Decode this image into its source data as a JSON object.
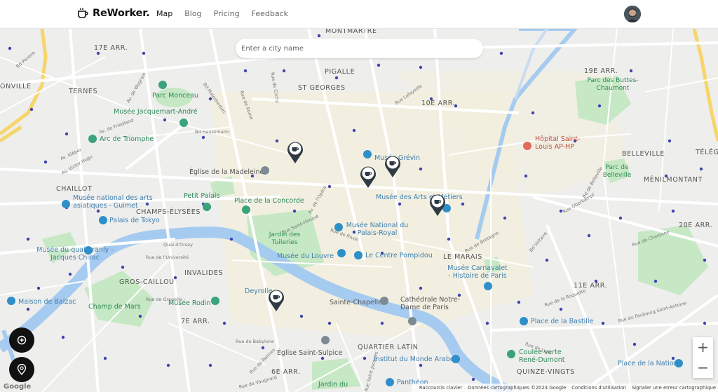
{
  "app": {
    "logo_text": "ReWorker.",
    "logo_icon": "coffee-cup-icon"
  },
  "nav": [
    {
      "label": "Map",
      "active": true
    },
    {
      "label": "Blog",
      "active": false
    },
    {
      "label": "Pricing",
      "active": false
    },
    {
      "label": "Feedback",
      "active": false
    }
  ],
  "search": {
    "placeholder": "Enter a city name",
    "value": ""
  },
  "map": {
    "districts": [
      "MONTMARTRE",
      "17E ARR.",
      "PIGALLE",
      "ST GEORGES",
      "19E ARR.",
      "10E ARR.",
      "BELLEVILLE",
      "TERNES",
      "CHAILLOT",
      "CHAMPS-ÉLYSÉES",
      "MÉNILMONTANT",
      "20E ARR.",
      "LE MARAIS",
      "INVALIDES",
      "GROS-CAILLOU",
      "11E ARR.",
      "7E ARR.",
      "QUARTIER LATIN",
      "6E ARR.",
      "QUINZE-VINGTS",
      "ONVILLE",
      "TÉLÉG"
    ],
    "pois": [
      {
        "label": "Parc Monceau",
        "kind": "green"
      },
      {
        "label": "Musée Jacquemart-André",
        "kind": "green"
      },
      {
        "label": "Parc des Buttes-Chaumont",
        "kind": "green"
      },
      {
        "label": "Arc de Triomphe",
        "kind": "green"
      },
      {
        "label": "Musée Grévin",
        "kind": "blue"
      },
      {
        "label": "Hôpital Saint-Louis AP-HP",
        "kind": "red"
      },
      {
        "label": "Église de la Madeleine",
        "kind": "gray"
      },
      {
        "label": "Parc de Belleville",
        "kind": "green"
      },
      {
        "label": "Musée national des arts asiatiques - Guimet",
        "kind": "blue"
      },
      {
        "label": "Petit Palais",
        "kind": "green"
      },
      {
        "label": "Place de la Concorde",
        "kind": "green"
      },
      {
        "label": "Musée des Arts et Métiers",
        "kind": "blue"
      },
      {
        "label": "Palais de Tokyo",
        "kind": "blue"
      },
      {
        "label": "Jardin des Tuileries",
        "kind": "green"
      },
      {
        "label": "Musée National du Palais-Royal",
        "kind": "blue"
      },
      {
        "label": "Musée du quai Branly - Jacques Chirac",
        "kind": "blue"
      },
      {
        "label": "Musée du Louvre",
        "kind": "blue"
      },
      {
        "label": "Le Centre Pompidou",
        "kind": "blue"
      },
      {
        "label": "Musée Carnavalet - Histoire de Paris",
        "kind": "blue"
      },
      {
        "label": "Deyrolle",
        "kind": "blue"
      },
      {
        "label": "Maison de Balzac",
        "kind": "blue"
      },
      {
        "label": "Champ de Mars",
        "kind": "green"
      },
      {
        "label": "Musée Rodin",
        "kind": "green"
      },
      {
        "label": "Sainte-Chapelle",
        "kind": "gray"
      },
      {
        "label": "Cathédrale Notre-Dame de Paris",
        "kind": "gray"
      },
      {
        "label": "Place de la Bastille",
        "kind": "blue"
      },
      {
        "label": "Église Saint-Sulpice",
        "kind": "gray"
      },
      {
        "label": "Institut du Monde Arabe",
        "kind": "blue"
      },
      {
        "label": "Coulée verte René-Dumont",
        "kind": "green"
      },
      {
        "label": "Place de la Nation",
        "kind": "blue"
      },
      {
        "label": "Panthéon",
        "kind": "blue"
      },
      {
        "label": "Jardin du",
        "kind": "green"
      }
    ],
    "streets": [
      "Bd Pereire",
      "Av. de Wagram",
      "Bd Malesherbes",
      "Rue de Rome",
      "Rue de Clichy",
      "Bd Haussmann",
      "Av. de Friedland",
      "Av. Kléber",
      "Av. Victor Hugo",
      "Rue de Rivoli",
      "Quai d'Orsay",
      "Rue de l'Université",
      "Rue de Grenelle",
      "Rue de Babylone",
      "Rue de Vaugirard",
      "Rue de Rennes",
      "Bd Voltaire",
      "Rue de la Roquette",
      "Rue de Charonne",
      "Bd de Belleville",
      "Rue de Bretagne",
      "Rue Oberkampf",
      "Rue Saint-Honoré",
      "Av. de l'Opéra",
      "Rue Saint-Jacques",
      "Rue de Lyon",
      "Rue Lafayette",
      "Rue du Faubourg Saint-Antoine"
    ],
    "cafe_marker_icon": "coffee-map-marker-icon",
    "cafe_count": 6
  },
  "controls": {
    "add_location_icon": "add-location-icon",
    "my_location_icon": "location-pin-icon",
    "zoom_in": "+",
    "zoom_out": "−"
  },
  "attribution": {
    "google": "Google",
    "shortcuts": "Raccourcis clavier",
    "data": "Données cartographiques ©2024 Google",
    "terms": "Conditions d'utilisation",
    "report": "Signaler une erreur cartographique"
  },
  "colors": {
    "map_bg": "#eeeeec",
    "water": "#a6cbf0",
    "park": "#c6e8c4",
    "road": "#ffffff",
    "highway": "#f7d56a",
    "marker": "#2f3a44"
  }
}
